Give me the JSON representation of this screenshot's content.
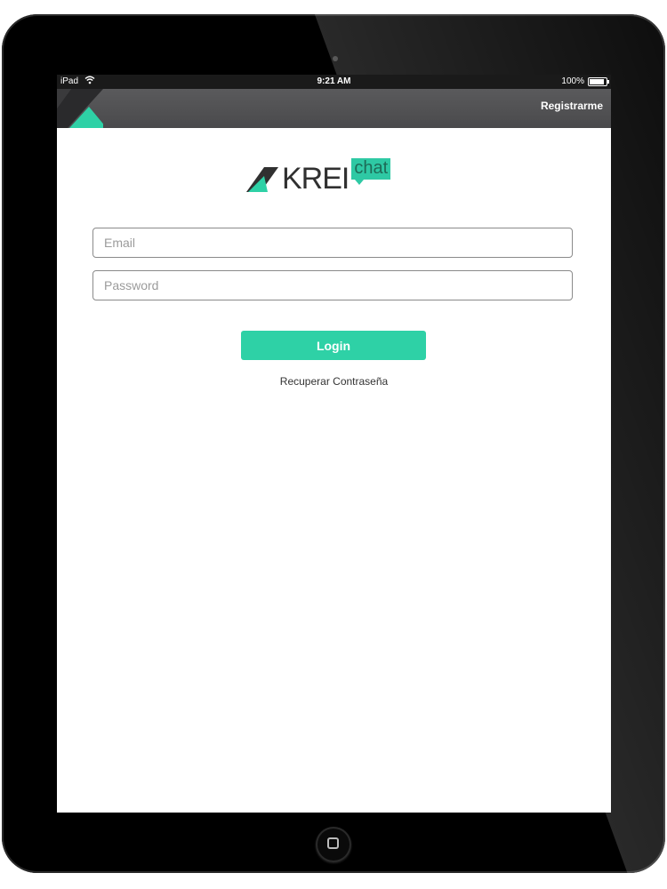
{
  "device": {
    "model_label": "iPad",
    "time": "9:21 AM",
    "battery_text": "100%",
    "battery_level": 1.0
  },
  "navbar": {
    "register_label": "Registrarme"
  },
  "brand": {
    "name": "KREI",
    "chat": "chat",
    "accent_color": "#2ed1a6"
  },
  "login_form": {
    "email_placeholder": "Email",
    "password_placeholder": "Password",
    "login_label": "Login",
    "recover_label": "Recuperar Contraseña"
  },
  "icons": {
    "wifi": "wifi-icon",
    "battery": "battery-icon",
    "logo": "krei-logo-icon",
    "home": "home-button-icon"
  }
}
